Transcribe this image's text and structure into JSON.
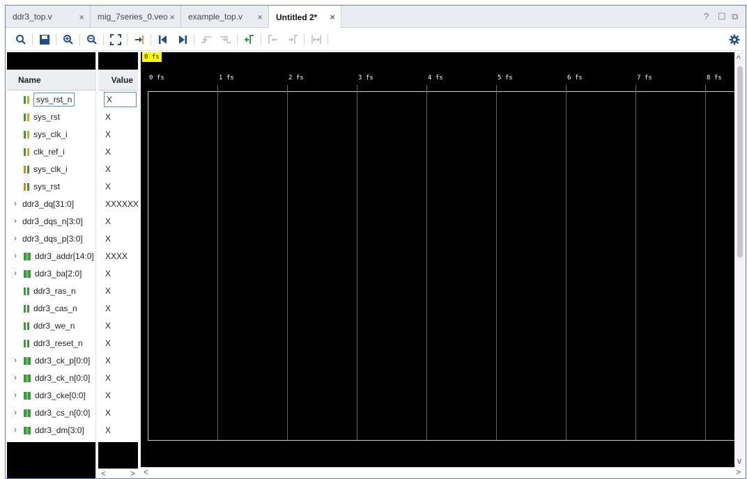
{
  "tabs": [
    {
      "label": "ddr3_top.v",
      "active": false
    },
    {
      "label": "mig_7series_0.veo",
      "active": false
    },
    {
      "label": "example_top.v",
      "active": false
    },
    {
      "label": "Untitled 2*",
      "active": true
    }
  ],
  "tab_close": "×",
  "window_controls": {
    "help": "?",
    "restore": "☐",
    "popout": "⧉"
  },
  "toolbar": {
    "icons": [
      "search-icon",
      "save-icon",
      "zoom-in-icon",
      "zoom-out-icon",
      "zoom-fit-icon",
      "go-to-cursor-icon",
      "go-to-time-0-icon",
      "go-to-last-time-icon",
      "previous-transition-icon",
      "next-transition-icon",
      "add-marker-icon",
      "previous-marker-icon",
      "next-marker-icon",
      "swap-cursors-icon",
      "settings-icon"
    ]
  },
  "headers": {
    "name": "Name",
    "value": "Value"
  },
  "signals": [
    {
      "name": "sys_rst_n",
      "value": "X",
      "icon": "yellow",
      "expandable": false,
      "selected": true
    },
    {
      "name": "sys_rst",
      "value": "X",
      "icon": "yellow",
      "expandable": false,
      "selected": false
    },
    {
      "name": "sys_clk_i",
      "value": "X",
      "icon": "yellow",
      "expandable": false,
      "selected": false
    },
    {
      "name": "clk_ref_i",
      "value": "X",
      "icon": "yellow",
      "expandable": false,
      "selected": false
    },
    {
      "name": "sys_clk_i",
      "value": "X",
      "icon": "orange",
      "expandable": false,
      "selected": false
    },
    {
      "name": "sys_rst",
      "value": "X",
      "icon": "orange",
      "expandable": false,
      "selected": false
    },
    {
      "name": "ddr3_dq[31:0]",
      "value": "XXXXXXXX",
      "icon": "none",
      "expandable": true,
      "selected": false
    },
    {
      "name": "ddr3_dqs_n[3:0]",
      "value": "X",
      "icon": "none",
      "expandable": true,
      "selected": false
    },
    {
      "name": "ddr3_dqs_p[3:0]",
      "value": "X",
      "icon": "none",
      "expandable": true,
      "selected": false
    },
    {
      "name": "ddr3_addr[14:0]",
      "value": "XXXX",
      "icon": "bus",
      "expandable": true,
      "selected": false
    },
    {
      "name": "ddr3_ba[2:0]",
      "value": "X",
      "icon": "bus",
      "expandable": true,
      "selected": false
    },
    {
      "name": "ddr3_ras_n",
      "value": "X",
      "icon": "green",
      "expandable": false,
      "selected": false
    },
    {
      "name": "ddr3_cas_n",
      "value": "X",
      "icon": "green",
      "expandable": false,
      "selected": false
    },
    {
      "name": "ddr3_we_n",
      "value": "X",
      "icon": "green",
      "expandable": false,
      "selected": false
    },
    {
      "name": "ddr3_reset_n",
      "value": "X",
      "icon": "green",
      "expandable": false,
      "selected": false
    },
    {
      "name": "ddr3_ck_p[0:0]",
      "value": "X",
      "icon": "bus",
      "expandable": true,
      "selected": false
    },
    {
      "name": "ddr3_ck_n[0:0]",
      "value": "X",
      "icon": "bus",
      "expandable": true,
      "selected": false
    },
    {
      "name": "ddr3_cke[0:0]",
      "value": "X",
      "icon": "bus",
      "expandable": true,
      "selected": false
    },
    {
      "name": "ddr3_cs_n[0:0]",
      "value": "X",
      "icon": "bus",
      "expandable": true,
      "selected": false
    },
    {
      "name": "ddr3_dm[3:0]",
      "value": "X",
      "icon": "bus",
      "expandable": true,
      "selected": false
    }
  ],
  "waveform": {
    "cursor_label": "0 fs",
    "time_ticks": [
      "0 fs",
      "1 fs",
      "2 fs",
      "3 fs",
      "4 fs",
      "5 fs",
      "6 fs",
      "7 fs",
      "8 fs"
    ],
    "background": "#000000",
    "cursor_color": "#ffff00"
  },
  "scroll": {
    "left": "<",
    "right": ">",
    "up": "^",
    "down": "v"
  }
}
